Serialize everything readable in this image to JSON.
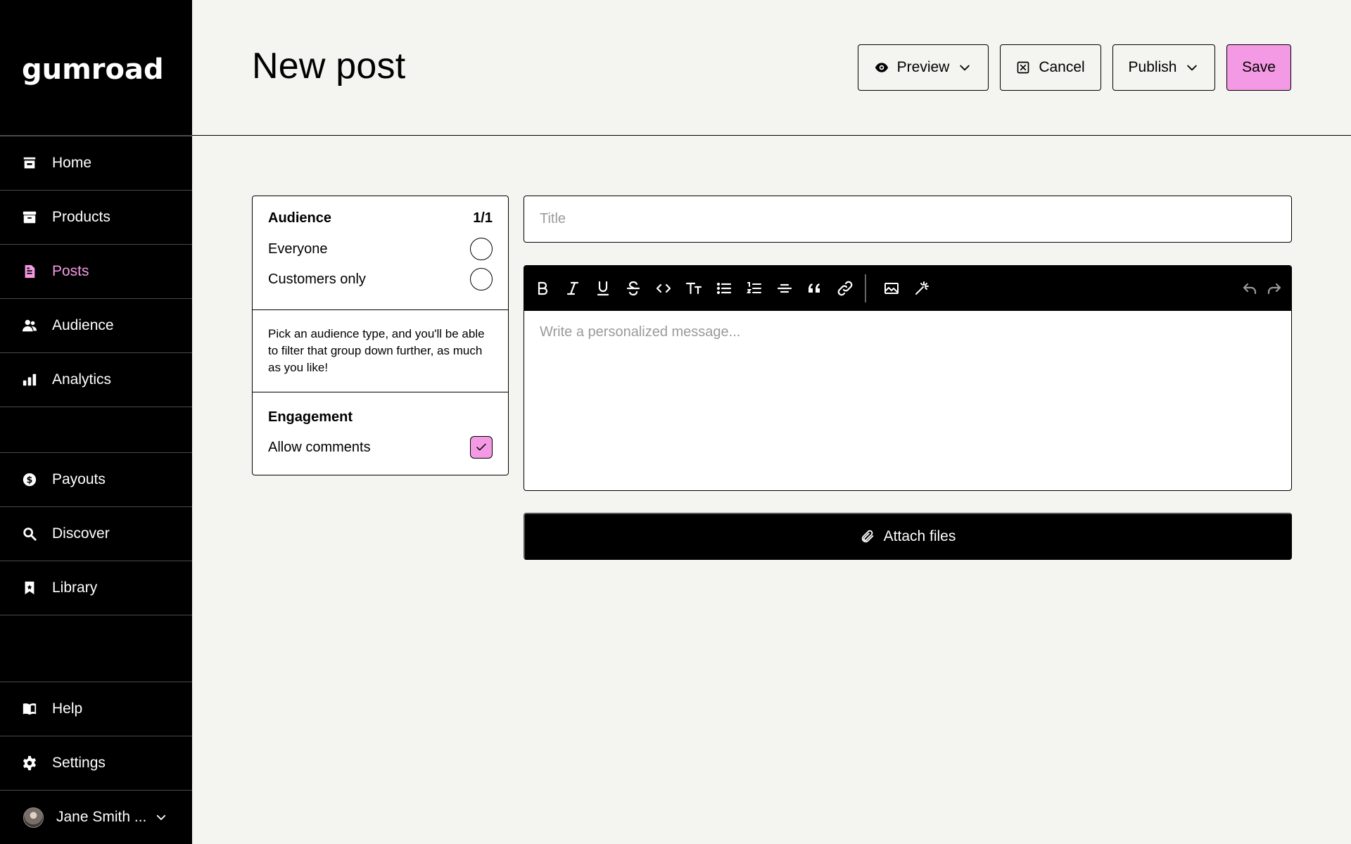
{
  "sidebar": {
    "logo_text": "GUMROAD",
    "items": [
      {
        "label": "Home",
        "icon": "store-icon"
      },
      {
        "label": "Products",
        "icon": "archive-icon"
      },
      {
        "label": "Posts",
        "icon": "document-icon",
        "active": true
      },
      {
        "label": "Audience",
        "icon": "people-icon"
      },
      {
        "label": "Analytics",
        "icon": "bar-chart-icon"
      },
      {
        "label": "Payouts",
        "icon": "dollar-circle-icon"
      },
      {
        "label": "Discover",
        "icon": "search-icon"
      },
      {
        "label": "Library",
        "icon": "bookmark-icon"
      },
      {
        "label": "Help",
        "icon": "book-icon"
      },
      {
        "label": "Settings",
        "icon": "gear-icon"
      }
    ],
    "user": {
      "name": "Jane Smith ..."
    },
    "active_color": "#f49ae4"
  },
  "header": {
    "title": "New post",
    "preview_label": "Preview",
    "cancel_label": "Cancel",
    "publish_label": "Publish",
    "save_label": "Save"
  },
  "audience": {
    "heading": "Audience",
    "count": "1/1",
    "options": [
      {
        "label": "Everyone",
        "selected": false
      },
      {
        "label": "Customers only",
        "selected": false
      }
    ],
    "help_text": "Pick an audience type, and you'll be able to filter that group down further, as much as you like!",
    "engagement_heading": "Engagement",
    "allow_comments_label": "Allow comments",
    "allow_comments_checked": true
  },
  "post": {
    "title_placeholder": "Title",
    "title_value": "",
    "body_placeholder": "Write a personalized message..."
  },
  "toolbar": {
    "buttons": [
      "bold-icon",
      "italic-icon",
      "underline-icon",
      "strikethrough-icon",
      "code-icon",
      "text-size-icon",
      "bullet-list-icon",
      "numbered-list-icon",
      "horizontal-rule-icon",
      "quote-icon",
      "link-icon",
      "image-icon",
      "magic-icon",
      "undo-icon",
      "redo-icon"
    ]
  },
  "attach": {
    "label": "Attach files"
  },
  "colors": {
    "accent": "#f49ae4",
    "background": "#f4f4f0"
  }
}
